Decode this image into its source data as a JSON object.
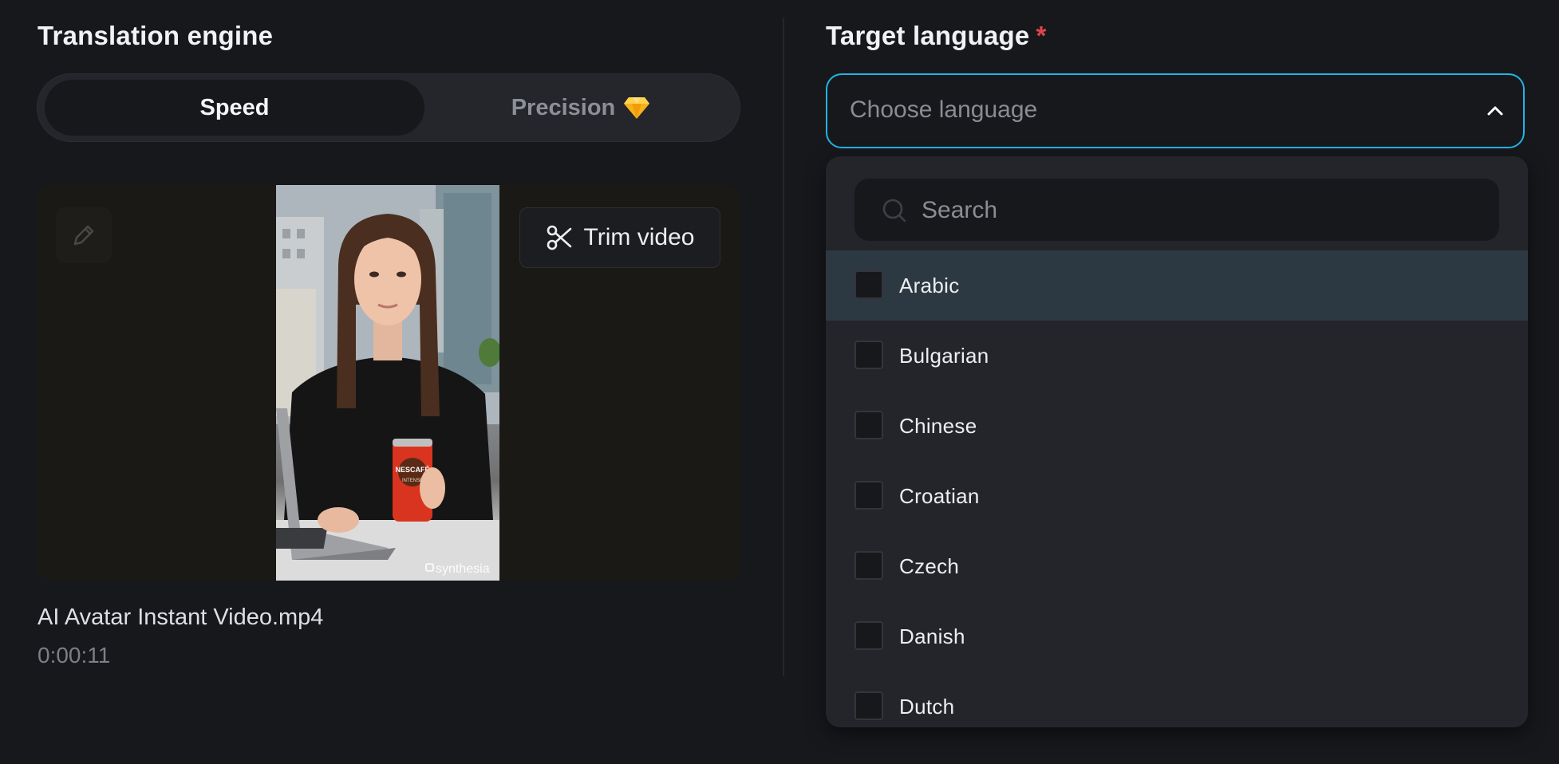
{
  "engine": {
    "title": "Translation engine",
    "options": [
      {
        "label": "Speed",
        "selected": true
      },
      {
        "label": "Precision",
        "selected": false,
        "icon": "gem-icon"
      }
    ]
  },
  "video": {
    "trim_label": "Trim video",
    "watermark": "synthesia",
    "can_label": "NESCAFÉ",
    "can_sublabel": "INTENSE",
    "file_name": "AI Avatar Instant Video.mp4",
    "duration": "0:00:11"
  },
  "target": {
    "title": "Target language",
    "required_mark": "*",
    "placeholder": "Choose language",
    "search_placeholder": "Search",
    "languages": [
      {
        "label": "Arabic",
        "highlighted": true
      },
      {
        "label": "Bulgarian",
        "highlighted": false
      },
      {
        "label": "Chinese",
        "highlighted": false
      },
      {
        "label": "Croatian",
        "highlighted": false
      },
      {
        "label": "Czech",
        "highlighted": false
      },
      {
        "label": "Danish",
        "highlighted": false
      },
      {
        "label": "Dutch",
        "highlighted": false
      }
    ]
  },
  "colors": {
    "accent": "#22b4e6",
    "required": "#e0454a",
    "highlight_row": "#2c3942",
    "background": "#17181c"
  }
}
